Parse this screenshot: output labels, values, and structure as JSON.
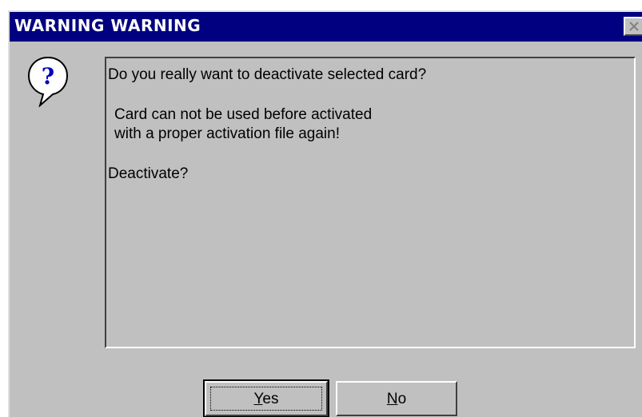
{
  "dialog": {
    "title": "WARNING WARNING",
    "icon": "question-icon",
    "message": {
      "line1": "Do you really want to deactivate selected card?",
      "line2": "Card can not be used before activated",
      "line3": "with a proper activation file again!",
      "line4": "Deactivate?"
    },
    "buttons": {
      "yes": {
        "mnemonic": "Y",
        "rest": "es"
      },
      "no": {
        "mnemonic": "N",
        "rest": "o"
      }
    }
  },
  "colors": {
    "title_bar": "#000080",
    "face": "#c0c0c0",
    "title_text": "#ffffff",
    "icon_mark": "#0000c0"
  }
}
